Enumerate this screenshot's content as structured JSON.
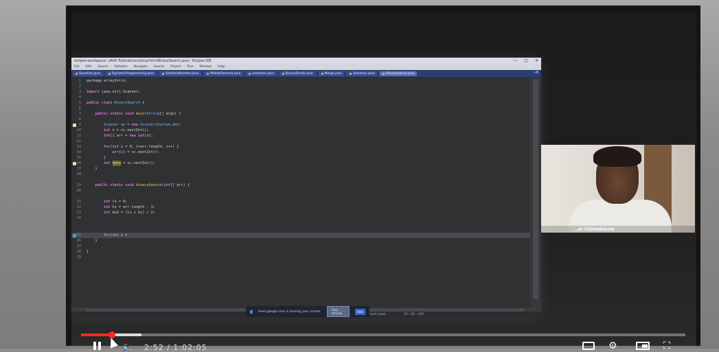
{
  "eclipse": {
    "title": "eclipse-workspace - JAVA Tutorials/src/arrayIntro/BinarySearch.java - Eclipse IDE",
    "win_controls": [
      "—",
      "□",
      "✕"
    ],
    "menu": [
      "File",
      "Edit",
      "Source",
      "Refactor",
      "Navigate",
      "Search",
      "Project",
      "Run",
      "Window",
      "Help"
    ],
    "tabs": [
      "Question.java",
      "DynamicProgramming.java",
      "SmallestNumber.java",
      "MiddleElement.java",
      "Selection.java",
      "BinaryDivide.java",
      "Merge.java",
      "Question.java",
      "BinarySearch.java"
    ],
    "tab_overflow": "»8",
    "code": {
      "l1": "package arrayIntro;",
      "l3a": "import",
      "l3b": " java.util.Scanner;",
      "l5a": "public class",
      "l5b": "BinarySearch",
      "l5c": " {",
      "l7a": "public static void",
      "l7b": "main",
      "l7c": "(",
      "l7d": "String",
      "l7e": "[] args) {",
      "l9a": "Scanner",
      "l9b": " sc = ",
      "l9c": "new",
      "l9d": "Scanner",
      "l9e": "(",
      "l9f": "System",
      "l9g": ".in);",
      "l10a": "int",
      "l10b": " n = sc.nextInt();",
      "l11a": "int",
      "l11b": "[] arr = ",
      "l11c": "new",
      "l11d": "int",
      "l11e": "[n];",
      "l13a": "for",
      "l13b": "(",
      "l13c": "int",
      "l13d": " i = 0; i<arr.length; i++) {",
      "l14": "arr[i] = sc.nextInt();",
      "l15": "}",
      "l16a": "int",
      "l16b": "data",
      "l16c": " = sc.nextInt();",
      "l17": "}",
      "l19a": "public static void",
      "l19b": "binarySearch",
      "l19c": "(",
      "l19d": "int",
      "l19e": "[] arr) {",
      "l21a": "int",
      "l21b": " lo = 0;",
      "l22a": "int",
      "l22b": " hi = arr.length - 1;",
      "l23a": "int",
      "l23b": " mid = (lo + hi) / 2;",
      "l25a": "for",
      "l25b": "(",
      "l25c": "int",
      "l25d": " i = ",
      "l26": "}",
      "l28": "}"
    },
    "status": [
      "Smart Insert",
      "25 : 16 : 419"
    ]
  },
  "share_bar": {
    "text": "meet.google.com is sharing your screen.",
    "stop_label": "Stop sharing",
    "hide_label": "Hide"
  },
  "webcam": {
    "name": "...ar Vishwakarma"
  },
  "player": {
    "progress_fraction": 0.05,
    "buffered_fraction": 0.1,
    "time": "2:52 / 1:02:05",
    "accent": "#ff2a1a"
  }
}
